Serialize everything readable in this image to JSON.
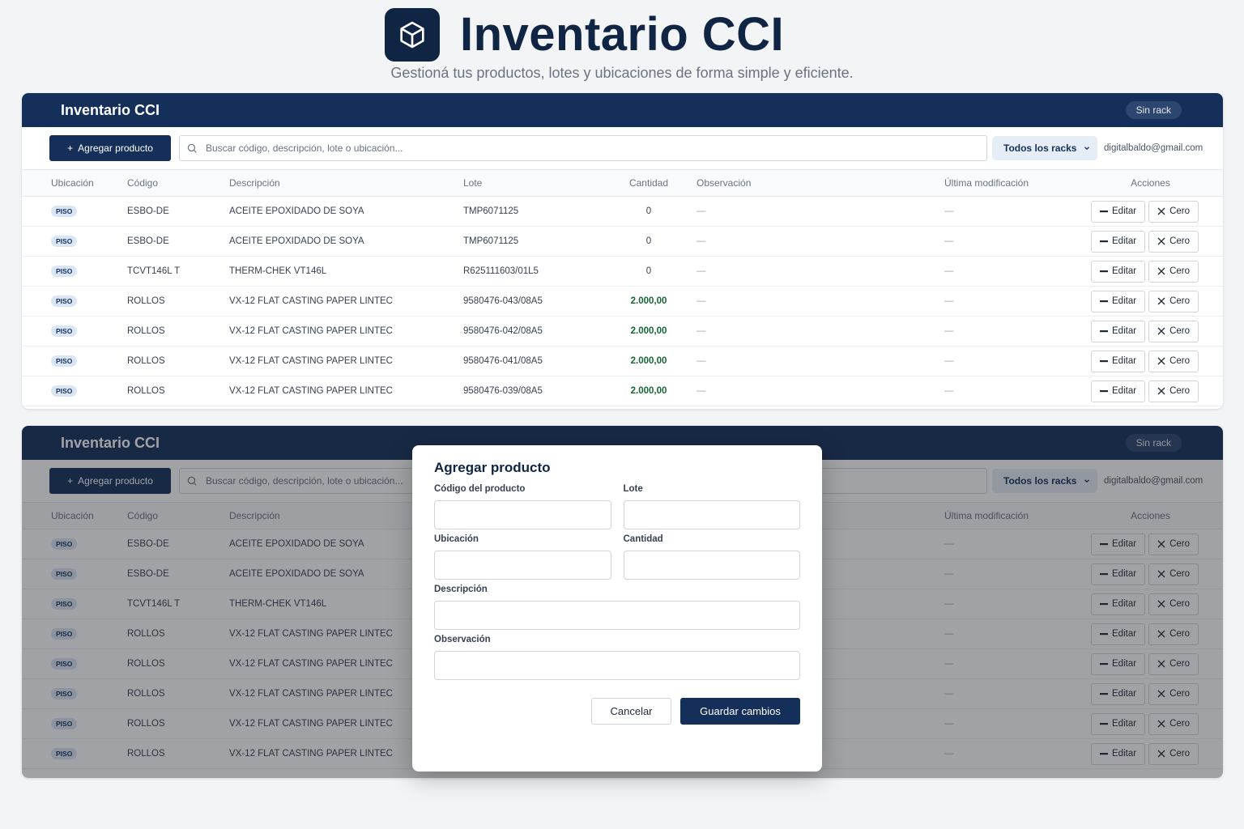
{
  "hero": {
    "title": "Inventario CCI",
    "subtitle": "Gestioná tus productos, lotes y ubicaciones de forma simple y eficiente."
  },
  "panel": {
    "title": "Inventario CCI",
    "badge": "Sin rack",
    "add_button": "Agregar producto",
    "search_placeholder": "Buscar código, descripción, lote o ubicación...",
    "rack_filter": "Todos los racks",
    "user_email": "digitalbaldo@gmail.com"
  },
  "columns": {
    "ubicacion": "Ubicación",
    "codigo": "Código",
    "descripcion": "Descripción",
    "lote": "Lote",
    "cantidad": "Cantidad",
    "observacion": "Observación",
    "modificacion": "Última modificación",
    "acciones": "Acciones"
  },
  "actions": {
    "edit": "Editar",
    "zero": "Cero"
  },
  "empty_value": "—",
  "rows": [
    {
      "ubicacion": "PISO",
      "codigo": "ESBO-DE",
      "descripcion": "ACEITE EPOXIDADO DE SOYA",
      "lote": "TMP6071125",
      "cantidad": "0",
      "observacion": "—",
      "modificacion": "—"
    },
    {
      "ubicacion": "PISO",
      "codigo": "ESBO-DE",
      "descripcion": "ACEITE EPOXIDADO DE SOYA",
      "lote": "TMP6071125",
      "cantidad": "0",
      "observacion": "—",
      "modificacion": "—"
    },
    {
      "ubicacion": "PISO",
      "codigo": "TCVT146L T",
      "descripcion": "THERM-CHEK VT146L",
      "lote": "R625111603/01L5",
      "cantidad": "0",
      "observacion": "—",
      "modificacion": "—"
    },
    {
      "ubicacion": "PISO",
      "codigo": "ROLLOS",
      "descripcion": "VX-12 FLAT CASTING PAPER LINTEC",
      "lote": "9580476-043/08A5",
      "cantidad": "2.000,00",
      "observacion": "—",
      "modificacion": "—"
    },
    {
      "ubicacion": "PISO",
      "codigo": "ROLLOS",
      "descripcion": "VX-12 FLAT CASTING PAPER LINTEC",
      "lote": "9580476-042/08A5",
      "cantidad": "2.000,00",
      "observacion": "—",
      "modificacion": "—"
    },
    {
      "ubicacion": "PISO",
      "codigo": "ROLLOS",
      "descripcion": "VX-12 FLAT CASTING PAPER LINTEC",
      "lote": "9580476-041/08A5",
      "cantidad": "2.000,00",
      "observacion": "—",
      "modificacion": "—"
    },
    {
      "ubicacion": "PISO",
      "codigo": "ROLLOS",
      "descripcion": "VX-12 FLAT CASTING PAPER LINTEC",
      "lote": "9580476-039/08A5",
      "cantidad": "2.000,00",
      "observacion": "—",
      "modificacion": "—"
    }
  ],
  "rows_bg": [
    {
      "ubicacion": "PISO",
      "codigo": "ESBO-DE",
      "descripcion": "ACEITE EPOXIDADO DE SOYA",
      "modificacion": "—"
    },
    {
      "ubicacion": "PISO",
      "codigo": "ESBO-DE",
      "descripcion": "ACEITE EPOXIDADO DE SOYA",
      "modificacion": "—"
    },
    {
      "ubicacion": "PISO",
      "codigo": "TCVT146L T",
      "descripcion": "THERM-CHEK VT146L",
      "modificacion": "—"
    },
    {
      "ubicacion": "PISO",
      "codigo": "ROLLOS",
      "descripcion": "VX-12 FLAT CASTING PAPER LINTEC",
      "modificacion": "—"
    },
    {
      "ubicacion": "PISO",
      "codigo": "ROLLOS",
      "descripcion": "VX-12 FLAT CASTING PAPER LINTEC",
      "modificacion": "—"
    },
    {
      "ubicacion": "PISO",
      "codigo": "ROLLOS",
      "descripcion": "VX-12 FLAT CASTING PAPER LINTEC",
      "modificacion": "—"
    },
    {
      "ubicacion": "PISO",
      "codigo": "ROLLOS",
      "descripcion": "VX-12 FLAT CASTING PAPER LINTEC",
      "modificacion": "—"
    },
    {
      "ubicacion": "PISO",
      "codigo": "ROLLOS",
      "descripcion": "VX-12 FLAT CASTING PAPER LINTEC",
      "modificacion": "—"
    }
  ],
  "modal": {
    "title": "Agregar producto",
    "codigo_label": "Código del producto",
    "lote_label": "Lote",
    "ubicacion_label": "Ubicación",
    "cantidad_label": "Cantidad",
    "descripcion_label": "Descripción",
    "observacion_label": "Observación",
    "cancel": "Cancelar",
    "save": "Guardar cambios"
  },
  "colors": {
    "brand": "#14305a",
    "positive_qty": "#166534"
  },
  "icons": {
    "logo": "box-icon",
    "search": "search-icon",
    "edit": "minus-icon",
    "zero": "x-icon",
    "dropdown": "chevron-down-icon"
  }
}
